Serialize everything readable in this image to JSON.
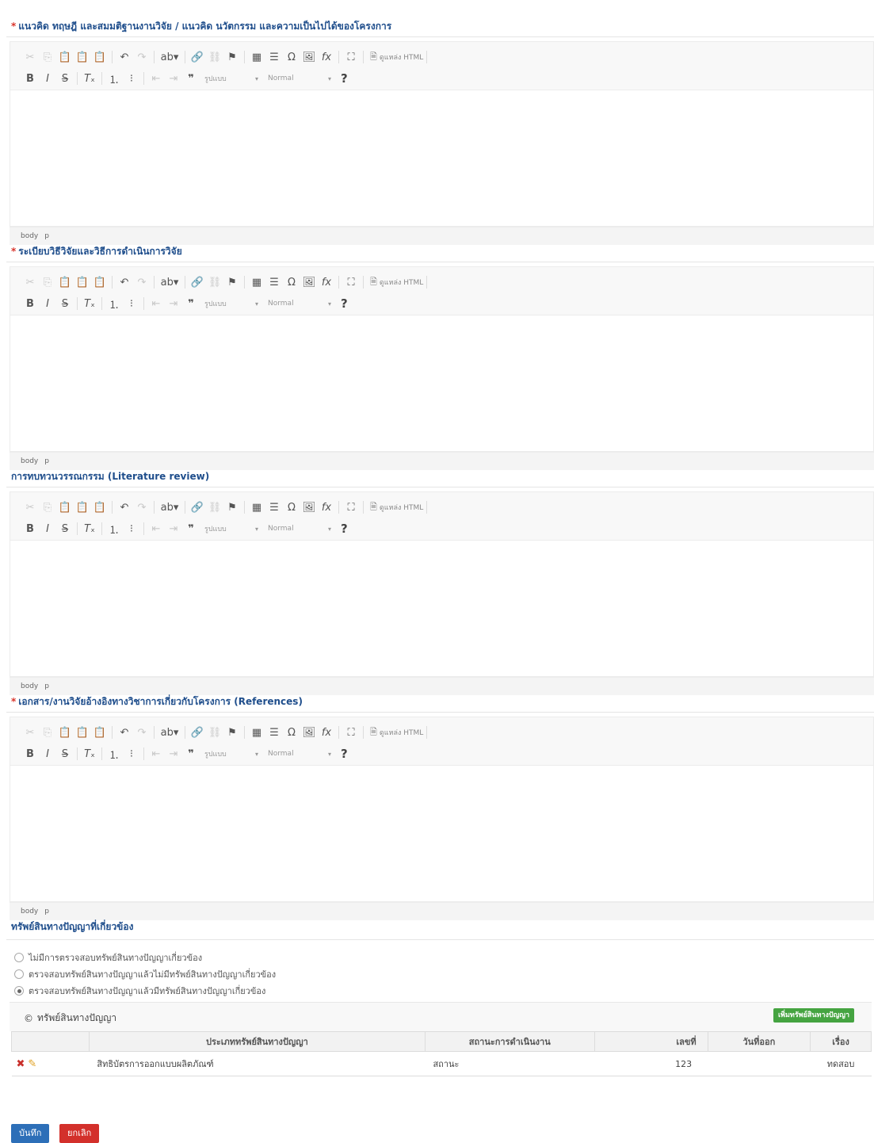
{
  "editor_toolbar": {
    "source_label": "ดูแหล่ง HTML",
    "format_combo": "รูปแบบ",
    "size_combo": "Normal",
    "help": "?"
  },
  "element_path": {
    "body": "body",
    "p": "p"
  },
  "sections": [
    {
      "title": "แนวคิด ทฤษฎี และสมมติฐานงานวิจัย / แนวคิด นวัตกรรม และความเป็นไปได้ของโครงการ",
      "required": true
    },
    {
      "title": "ระเบียบวิธีวิจัยและวิธีการดำเนินการวิจัย",
      "required": true
    },
    {
      "title": "การทบทวนวรรณกรรม (Literature review)",
      "required": false
    },
    {
      "title": "เอกสาร/งานวิจัยอ้างอิงทางวิชาการเกี่ยวกับโครงการ (References)",
      "required": true
    }
  ],
  "ip": {
    "title": "ทรัพย์สินทางปัญญาที่เกี่ยวข้อง",
    "options": [
      {
        "label": "ไม่มีการตรวจสอบทรัพย์สินทางปัญญาเกี่ยวข้อง",
        "selected": false
      },
      {
        "label": "ตรวจสอบทรัพย์สินทางปัญญาแล้วไม่มีทรัพย์สินทางปัญญาเกี่ยวข้อง",
        "selected": false
      },
      {
        "label": "ตรวจสอบทรัพย์สินทางปัญญาแล้วมีทรัพย์สินทางปัญญาเกี่ยวข้อง",
        "selected": true
      }
    ],
    "panel_title": "ทรัพย์สินทางปัญญา",
    "add_button": "เพิ่มทรัพย์สินทางปัญญา",
    "columns": [
      "ประเภททรัพย์สินทางปัญญา",
      "สถานะการดำเนินงาน",
      "เลขที่",
      "วันที่ออก",
      "เรื่อง"
    ],
    "rows": [
      {
        "type": "สิทธิบัตรการออกแบบผลิตภัณฑ์",
        "status": "สถานะ",
        "number": "123",
        "issued": "",
        "subject": "ทดสอบ"
      }
    ]
  },
  "buttons": {
    "save": "บันทึก",
    "cancel": "ยกเลิก"
  },
  "colors": {
    "title": "#1f4e8c",
    "required": "#d9342b",
    "save": "#2d6fb8",
    "cancel": "#d3302b",
    "add": "#45a441"
  }
}
